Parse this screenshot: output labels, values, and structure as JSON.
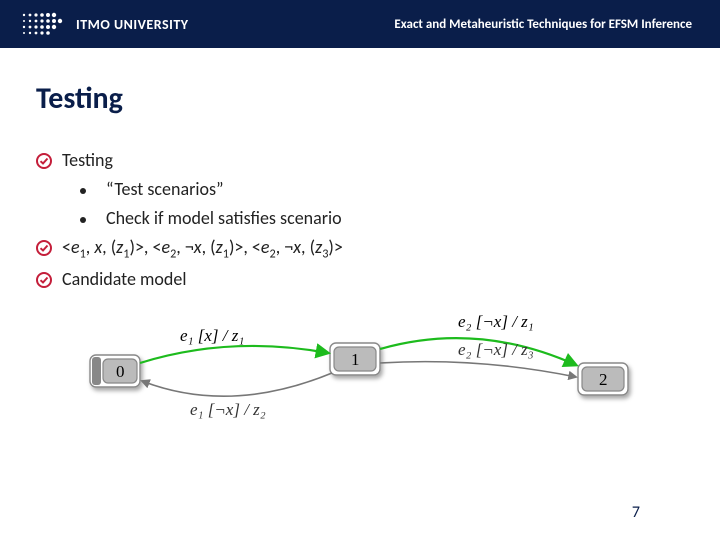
{
  "header": {
    "logo_label": "ITMO UNIVERSITY",
    "paper_title": "Exact and Metaheuristic Techniques for EFSM Inference"
  },
  "slide": {
    "title": "Testing",
    "bullets": {
      "b1": "Testing",
      "b1a": "“Test scenarios”",
      "b1b": "Check if model satisfies scenario",
      "b2_parts": {
        "lt1": "<",
        "e": "e",
        "one": "1",
        "comma1": ", ",
        "x1": "x",
        "comma2": ", (",
        "z": "z",
        "one2": "1",
        "gt1": ")>, <",
        "e2": "e",
        "two": "2",
        "neg": ", ¬",
        "x2": "x",
        "comma3": ", (",
        "z2": "z",
        "one3": "1",
        "gt2": ")>, <",
        "e3": "e",
        "two2": "2",
        "neg2": ", ¬",
        "x3": "x",
        "comma4": ", (",
        "z3": "z",
        "three": "3",
        "gt3": ")>"
      },
      "b3": "Candidate model"
    },
    "page_number": "7"
  },
  "diagram": {
    "states": {
      "s0": "0",
      "s1": "1",
      "s2": "2"
    },
    "edges": {
      "e01_top": "e₁ [x] / z₁",
      "e12_top": "e₂ [¬x] / z₁",
      "e12_mid": "e₂ [¬x] / z₃",
      "e10_bot": "e₁ [¬x] / z₂"
    }
  }
}
